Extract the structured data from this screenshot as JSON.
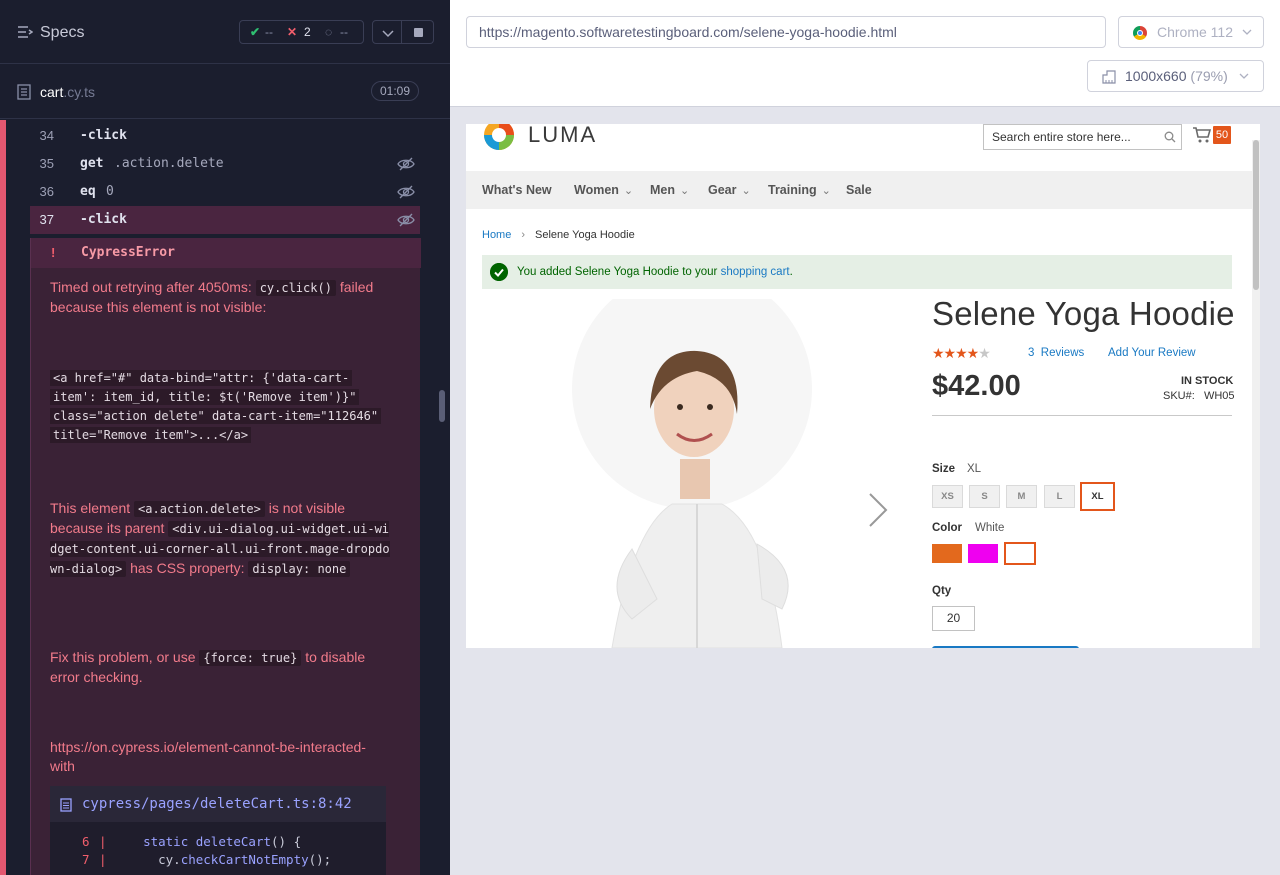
{
  "runner": {
    "specs_label": "Specs",
    "stats": {
      "passed": "--",
      "failed": "2",
      "pending": "--"
    },
    "file": {
      "name": "cart",
      "ext": ".cy.ts",
      "duration": "01:09"
    },
    "commands": [
      {
        "num": "34",
        "name": "-click",
        "arg": ""
      },
      {
        "num": "35",
        "name": "get",
        "arg": ".action.delete"
      },
      {
        "num": "36",
        "name": "eq",
        "arg": "0"
      },
      {
        "num": "37",
        "name": "-click",
        "arg": ""
      }
    ],
    "error": {
      "bang": "!",
      "title": "CypressError",
      "p1_a": "Timed out retrying after 4050ms: ",
      "p1_code": "cy.click()",
      "p1_b": " failed because this element is not visible:",
      "html_snippet_1": "<a href=\"#\" data-bind=\"attr: {'data-cart-",
      "html_snippet_2": "item': item_id, title: $t('Remove item')}\"",
      "html_snippet_3": "class=\"action delete\" data-cart-item=\"112646\"",
      "html_snippet_4": "title=\"Remove item\">...</a>",
      "p2_a": "This element ",
      "p2_code1": "<a.action.delete>",
      "p2_b": " is not visible because its parent ",
      "p2_code2": "<div.ui-dialog.ui-widget.ui-widget-content.ui-corner-all.ui-front.mage-dropdown-dialog>",
      "p2_c": " has CSS property: ",
      "p2_code3": "display: none",
      "p3_a": "Fix this problem, or use ",
      "p3_code": "{force: true}",
      "p3_b": " to disable error checking.",
      "link": "https://on.cypress.io/element-cannot-be-interacted-with",
      "snippet_path": "cypress/pages/deleteCart.ts:8:42",
      "snippet_lines": [
        {
          "ln": "6",
          "bar": "|",
          "pre": "  ",
          "kw": "static",
          "fn": " deleteCart",
          "rest": "() {"
        },
        {
          "ln": "7",
          "bar": "|",
          "pre": "    cy.",
          "kw": "",
          "fn": "checkCartNotEmpty",
          "rest": "();"
        }
      ]
    }
  },
  "browser": {
    "url": "https://magento.softwaretestingboard.com/selene-yoga-hoodie.html",
    "browser_label": "Chrome 112",
    "viewport_size": "1000x660",
    "viewport_scale": "(79%)"
  },
  "aut": {
    "logo": "LUMA",
    "search_placeholder": "Search entire store here...",
    "cart_count": "50",
    "nav": [
      "What's New",
      "Women",
      "Men",
      "Gear",
      "Training",
      "Sale"
    ],
    "breadcrumb": {
      "home": "Home",
      "current": "Selene Yoga Hoodie"
    },
    "message": {
      "text": "You added Selene Yoga Hoodie to your ",
      "link": "shopping cart",
      "end": "."
    },
    "product": {
      "title": "Selene Yoga Hoodie",
      "rating_stars": 4,
      "reviews_count": "3",
      "reviews_label": "Reviews",
      "add_review": "Add Your Review",
      "price": "$42.00",
      "stock": "IN STOCK",
      "sku_label": "SKU#:",
      "sku": "WH05",
      "size_label": "Size",
      "size_selected": "XL",
      "sizes": [
        "XS",
        "S",
        "M",
        "L",
        "XL"
      ],
      "color_label": "Color",
      "color_selected": "White",
      "colors": [
        "#e3691d",
        "#ef00f0",
        "#ffffff"
      ],
      "qty_label": "Qty",
      "qty": "20"
    }
  },
  "colors": {
    "accent_fail": "#f15e6c",
    "accent_pass": "#2fbf71",
    "luma_orange": "#e3561b",
    "luma_blue": "#1979c3"
  }
}
